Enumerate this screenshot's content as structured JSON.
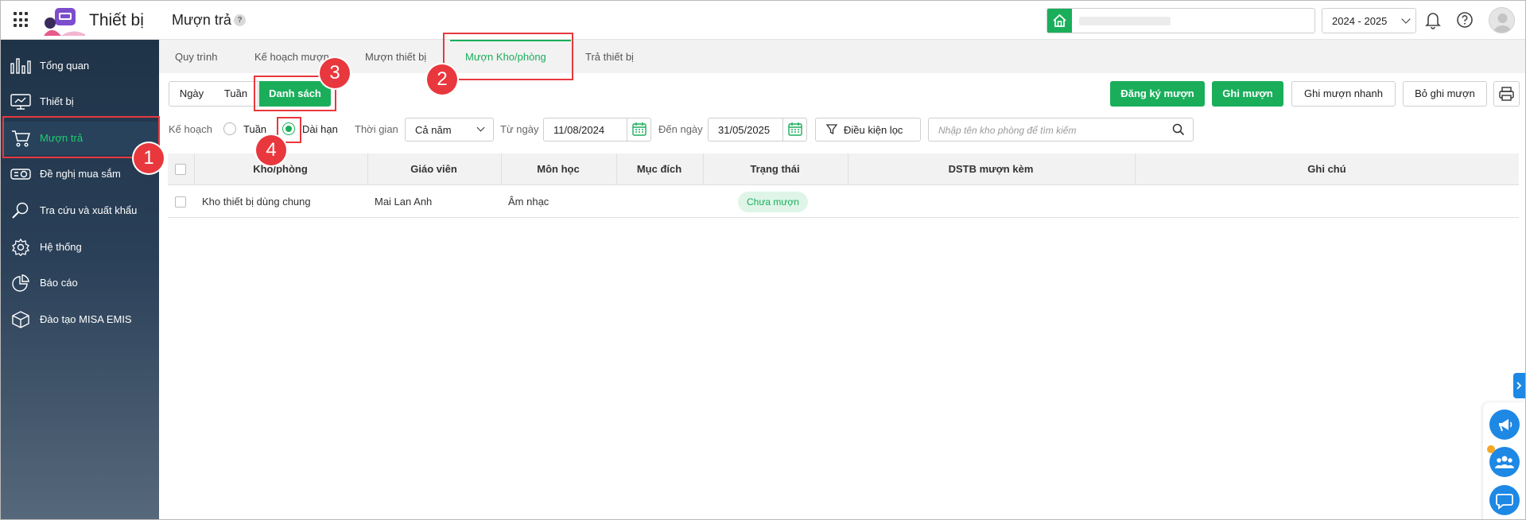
{
  "header": {
    "app_title": "Thiết bị",
    "page_title": "Mượn trả",
    "help_badge": "?",
    "school_year": "2024 - 2025"
  },
  "sidebar": {
    "items": [
      {
        "label": "Tổng quan",
        "icon": "chart-bars-icon"
      },
      {
        "label": "Thiết bị",
        "icon": "monitor-icon"
      },
      {
        "label": "Mượn trả",
        "icon": "cart-icon",
        "active": true
      },
      {
        "label": "Đề nghị mua sắm",
        "icon": "projector-icon"
      },
      {
        "label": "Tra cứu và xuất khẩu",
        "icon": "search-icon"
      },
      {
        "label": "Hệ thống",
        "icon": "gear-icon"
      },
      {
        "label": "Báo cáo",
        "icon": "pie-chart-icon"
      },
      {
        "label": "Đào tạo MISA EMIS",
        "icon": "cube-icon"
      }
    ]
  },
  "tabs": [
    {
      "label": "Quy trình"
    },
    {
      "label": "Kế hoạch mượn"
    },
    {
      "label": "Mượn thiết bị"
    },
    {
      "label": "Mượn Kho/phòng",
      "active": true
    },
    {
      "label": "Trả thiết bị"
    }
  ],
  "view_toggle": {
    "day": "Ngày",
    "week": "Tuần",
    "list": "Danh sách",
    "selected": "Danh sách"
  },
  "actions": {
    "register": "Đăng ký mượn",
    "record": "Ghi mượn",
    "record_quick": "Ghi mượn nhanh",
    "unrecord": "Bỏ ghi mượn"
  },
  "filters": {
    "plan_label": "Kế hoạch",
    "plan_week": "Tuần",
    "plan_long": "Dài hạn",
    "plan_selected": "Dài hạn",
    "time_label": "Thời gian",
    "time_value": "Cả năm",
    "from_label": "Từ ngày",
    "from_value": "11/08/2024",
    "to_label": "Đến ngày",
    "to_value": "31/05/2025",
    "condition_button": "Điều kiện lọc",
    "search_placeholder": "Nhập tên kho phòng để tìm kiếm"
  },
  "table": {
    "columns": [
      "Kho/phòng",
      "Giáo viên",
      "Môn học",
      "Mục đích",
      "Trạng thái",
      "DSTB mượn kèm",
      "Ghi chú"
    ],
    "rows": [
      {
        "room": "Kho thiết bị dùng chung",
        "teacher": "Mai Lan Anh",
        "subject": "Âm nhạc",
        "purpose": "",
        "status": "Chưa mượn",
        "dstb": "",
        "note": ""
      }
    ]
  },
  "annotations": [
    "1",
    "2",
    "3",
    "4"
  ],
  "colors": {
    "accent": "#1aae5b",
    "annotation": "#e8383d",
    "sidebar_top": "#1f3348",
    "float_button": "#1e88e5"
  }
}
